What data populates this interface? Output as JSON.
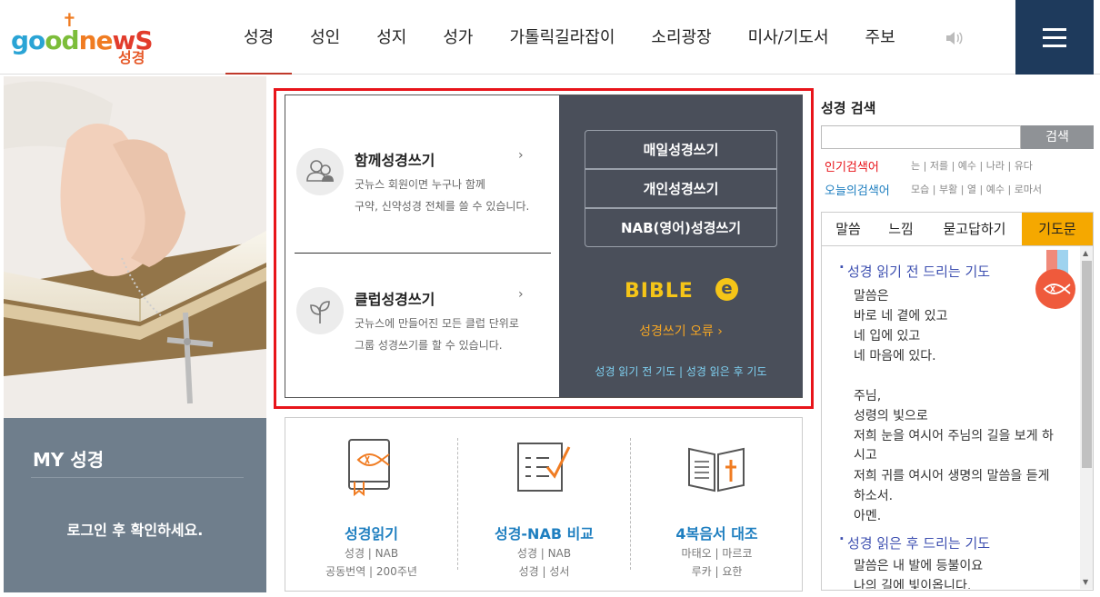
{
  "header": {
    "logo_text": "goodnews",
    "logo_sub": "성경",
    "nav": [
      "성경",
      "성인",
      "성지",
      "성가",
      "가톨릭길라잡이",
      "소리광장",
      "미사/기도서",
      "주보"
    ],
    "active_nav": "성경",
    "speaker_icon": "speaker-icon",
    "menu_icon": "hamburger-menu-icon"
  },
  "my": {
    "title": "MY 성경",
    "message": "로그인 후 확인하세요."
  },
  "write": {
    "items": [
      {
        "title": "함께성경쓰기",
        "desc1": "굿뉴스 회원이면 누구나 함께",
        "desc2": "구약, 신약성경 전체를 쓸 수 있습니다."
      },
      {
        "title": "클럽성경쓰기",
        "desc1": "굿뉴스에 만들어진 모든 클럽 단위로",
        "desc2": "그룹 성경쓰기를 할 수 있습니다."
      }
    ],
    "buttons": [
      "매일성경쓰기",
      "개인성경쓰기",
      "NAB(영어)성경쓰기"
    ],
    "bible_logo": "BIBLE",
    "bible_e": "e",
    "error_link": "성경쓰기 오류 ›",
    "pray_before": "성경 읽기 전 기도",
    "pray_sep": " | ",
    "pray_after": "성경 읽은 후 기도"
  },
  "features": [
    {
      "title": "성경읽기",
      "sub1": "성경 | NAB",
      "sub2": "공동번역 | 200주년"
    },
    {
      "title": "성경-NAB 비교",
      "sub1": "성경 | NAB",
      "sub2": "성경 | 성서"
    },
    {
      "title": "4복음서 대조",
      "sub1": "마태오 | 마르코",
      "sub2": "루카 | 요한"
    }
  ],
  "search": {
    "title": "성경 검색",
    "button": "검색",
    "popular_label": "인기검색어",
    "popular": [
      "는",
      "저를",
      "예수",
      "나라",
      "유다"
    ],
    "today_label": "오늘의검색어",
    "today": [
      "모습",
      "부활",
      "열",
      "예수",
      "로마서"
    ]
  },
  "tabs": [
    "말씀",
    "느낌",
    "묻고답하기",
    "기도문"
  ],
  "active_tab": "기도문",
  "prayer": {
    "before_title": "성경 읽기 전 드리는 기도",
    "before_lines": [
      "말씀은",
      "바로 네 곁에 있고",
      "네 입에 있고",
      "네 마음에 있다.",
      "",
      "주님,",
      "성령의 빛으로",
      "저희 눈을 여시어 주님의 길을 보게 하",
      "시고",
      "저희 귀를 여시어 생명의 말씀을 듣게",
      "하소서.",
      "아멘."
    ],
    "after_title": "성경 읽은 후 드리는 기도",
    "after_lines": [
      "말씀은 내 발에 등불이요",
      "나의 길에 빛이옵니다."
    ]
  },
  "colors": {
    "accent_red": "#e8141a",
    "nav_active_underline": "#c0392b",
    "dark_panel": "#4a4f5a",
    "menu_bg": "#1e3a5c",
    "my_bg": "#6f7e8c",
    "tab_active": "#f5a800",
    "link_blue": "#1f7fc0",
    "prayer_title": "#3d4fb0"
  }
}
